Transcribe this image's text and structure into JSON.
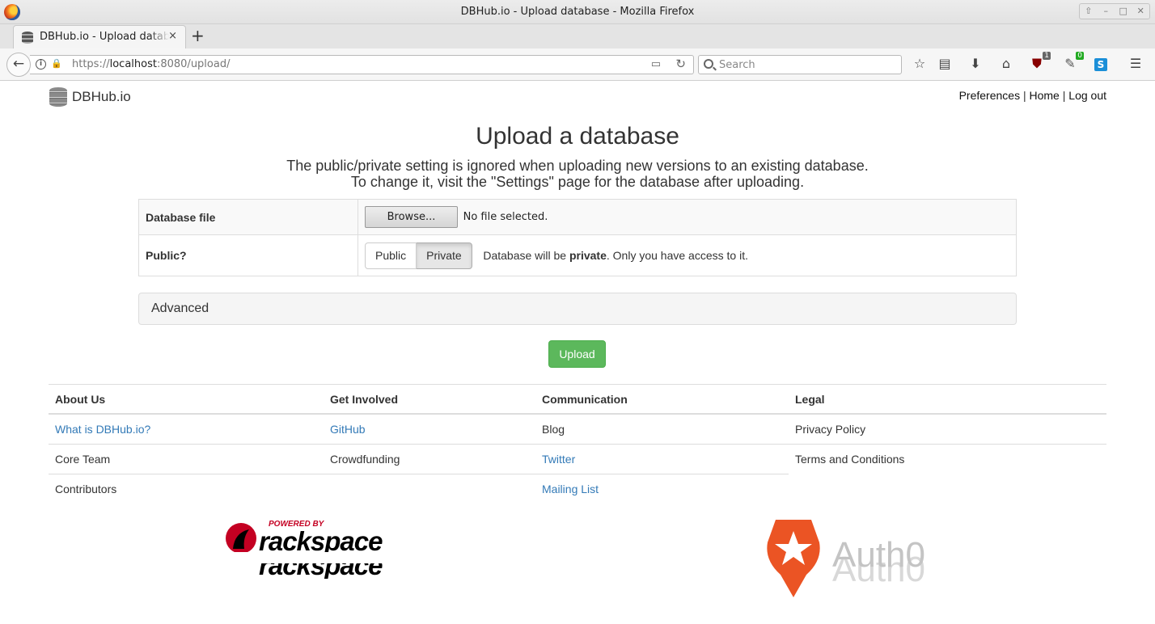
{
  "window": {
    "title": "DBHub.io - Upload database - Mozilla Firefox",
    "tab_title": "DBHub.io - Upload database",
    "tab_close": "×",
    "new_tab": "+"
  },
  "urlbar": {
    "scheme": "https://",
    "host": "localhost",
    "rest": ":8080/upload/"
  },
  "search": {
    "placeholder": "Search"
  },
  "toolbar_badges": {
    "ublock": "1",
    "extension": "0"
  },
  "header": {
    "brand": "DBHub.io",
    "links": [
      "Preferences",
      "Home",
      "Log out"
    ],
    "separator": "|"
  },
  "main": {
    "title": "Upload a database",
    "subtitle_line1": "The public/private setting is ignored when uploading new versions to an existing database.",
    "subtitle_line2": "To change it, visit the \"Settings\" page for the database after uploading.",
    "file_label": "Database file",
    "browse_label": "Browse...",
    "no_file_text": "No file selected.",
    "public_label": "Public?",
    "public_btn": "Public",
    "private_btn": "Private",
    "privacy_msg_prefix": "Database will be ",
    "privacy_msg_bold": "private",
    "privacy_msg_suffix": ". Only you have access to it.",
    "advanced_label": "Advanced",
    "upload_label": "Upload"
  },
  "footer": {
    "about": {
      "header": "About Us",
      "items": [
        "What is DBHub.io?",
        "Core Team",
        "Contributors"
      ]
    },
    "involved": {
      "header": "Get Involved",
      "items": [
        "GitHub",
        "Crowdfunding"
      ]
    },
    "communication": {
      "header": "Communication",
      "items": [
        "Blog",
        "Twitter",
        "Mailing List"
      ]
    },
    "legal": {
      "header": "Legal",
      "items": [
        "Privacy Policy",
        "Terms and Conditions"
      ]
    }
  },
  "sponsors": {
    "rackspace_powered": "POWERED BY",
    "rackspace_name": "rackspace",
    "auth0_name": "Auth0"
  },
  "colors": {
    "link": "#337ab7",
    "upload_green": "#5cb85c",
    "rackspace_red": "#c40022",
    "auth0_orange": "#eb5424"
  }
}
